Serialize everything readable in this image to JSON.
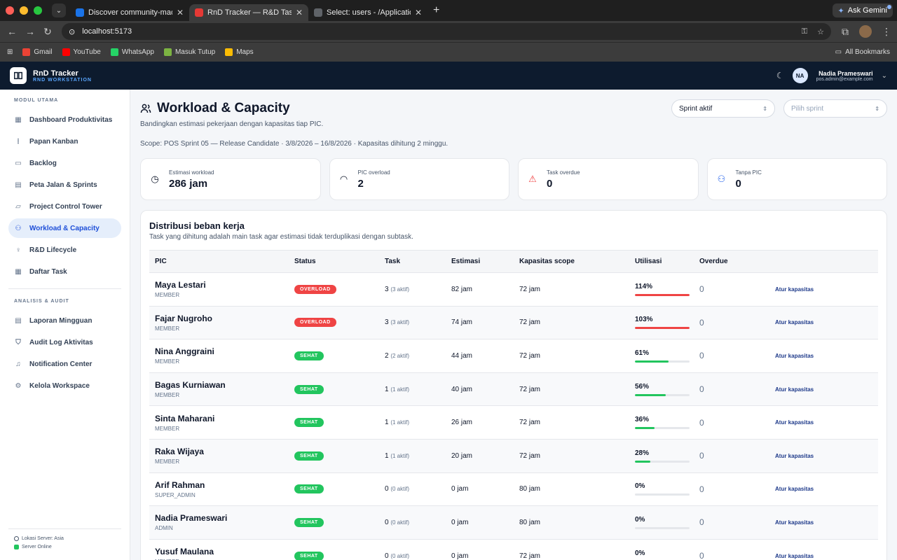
{
  "browser": {
    "tabs": [
      {
        "title": "Discover community-made U",
        "active": false,
        "color": "#1a73e8"
      },
      {
        "title": "RnD Tracker — R&D Task Man",
        "active": true,
        "color": "#e53935"
      },
      {
        "title": "Select: users - /Applications/",
        "active": false,
        "color": "#5f6368"
      }
    ],
    "gemini_label": "Ask Gemini",
    "url": "localhost:5173",
    "bookmarks": [
      {
        "label": "Gmail",
        "color": "#ea4335"
      },
      {
        "label": "YouTube",
        "color": "#ff0000"
      },
      {
        "label": "WhatsApp",
        "color": "#25d366"
      },
      {
        "label": "Masuk Tutup",
        "color": "#7cb342"
      },
      {
        "label": "Maps",
        "color": "#fbbc04"
      }
    ],
    "all_bookmarks": "All Bookmarks"
  },
  "header": {
    "brand_name": "RnD Tracker",
    "brand_sub": "RND WORKSTATION",
    "avatar_initials": "NA",
    "user_name": "Nadia Prameswari",
    "user_email": "pos.admin@example.com"
  },
  "sidebar": {
    "section1_title": "MODUL UTAMA",
    "section1_items": [
      {
        "label": "Dashboard Produktivitas",
        "icon": "grid-icon",
        "glyph": "▦",
        "active": false
      },
      {
        "label": "Papan Kanban",
        "icon": "kanban-icon",
        "glyph": "⦙",
        "active": false
      },
      {
        "label": "Backlog",
        "icon": "inbox-icon",
        "glyph": "▭",
        "active": false
      },
      {
        "label": "Peta Jalan & Sprints",
        "icon": "calendar-icon",
        "glyph": "▤",
        "active": false
      },
      {
        "label": "Project Control Tower",
        "icon": "folder-icon",
        "glyph": "▱",
        "active": false
      },
      {
        "label": "Workload & Capacity",
        "icon": "users-icon",
        "glyph": "⚇",
        "active": true
      },
      {
        "label": "R&D Lifecycle",
        "icon": "lightbulb-icon",
        "glyph": "♀",
        "active": false
      },
      {
        "label": "Daftar Task",
        "icon": "table-icon",
        "glyph": "▦",
        "active": false
      }
    ],
    "section2_title": "ANALISIS & AUDIT",
    "section2_items": [
      {
        "label": "Laporan Mingguan",
        "icon": "report-icon",
        "glyph": "▤",
        "active": false
      },
      {
        "label": "Audit Log Aktivitas",
        "icon": "shield-icon",
        "glyph": "⛉",
        "active": false
      },
      {
        "label": "Notification Center",
        "icon": "bell-icon",
        "glyph": "♫",
        "active": false
      },
      {
        "label": "Kelola Workspace",
        "icon": "gear-icon",
        "glyph": "⚙",
        "active": false
      }
    ],
    "server_location": "Lokasi Server: Asia",
    "server_status": "Server Online"
  },
  "page": {
    "title": "Workload & Capacity",
    "subtitle": "Bandingkan estimasi pekerjaan dengan kapasitas tiap PIC.",
    "scope": "Scope: POS Sprint 05 — Release Candidate · 3/8/2026 – 16/8/2026 · Kapasitas dihitung 2 minggu.",
    "filter_mode": "Sprint aktif",
    "filter_sprint_placeholder": "Pilih sprint"
  },
  "stats": [
    {
      "label": "Estimasi workload",
      "value": "286 jam",
      "icon": "clock-icon",
      "glyph": "◷",
      "color": "#0f172a"
    },
    {
      "label": "PIC overload",
      "value": "2",
      "icon": "gauge-icon",
      "glyph": "◠",
      "color": "#0f172a"
    },
    {
      "label": "Task overdue",
      "value": "0",
      "icon": "alert-icon",
      "glyph": "⚠",
      "color": "#ef4444"
    },
    {
      "label": "Tanpa PIC",
      "value": "0",
      "icon": "users-icon",
      "glyph": "⚇",
      "color": "#2563eb"
    }
  ],
  "table": {
    "title": "Distribusi beban kerja",
    "subtitle": "Task yang dihitung adalah main task agar estimasi tidak terduplikasi dengan subtask.",
    "columns": [
      "PIC",
      "Status",
      "Task",
      "Estimasi",
      "Kapasitas scope",
      "Utilisasi",
      "Overdue",
      ""
    ],
    "action_label": "Atur kapasitas",
    "colors": {
      "overload": "#ef4444",
      "sehat": "#22c55e"
    },
    "rows": [
      {
        "name": "Maya Lestari",
        "role": "MEMBER",
        "status": "OVERLOAD",
        "task": "3",
        "active": "(3 aktif)",
        "estimate": "82 jam",
        "capacity": "72 jam",
        "util": "114%",
        "util_value": 114,
        "overdue": "0"
      },
      {
        "name": "Fajar Nugroho",
        "role": "MEMBER",
        "status": "OVERLOAD",
        "task": "3",
        "active": "(3 aktif)",
        "estimate": "74 jam",
        "capacity": "72 jam",
        "util": "103%",
        "util_value": 103,
        "overdue": "0"
      },
      {
        "name": "Nina Anggraini",
        "role": "MEMBER",
        "status": "SEHAT",
        "task": "2",
        "active": "(2 aktif)",
        "estimate": "44 jam",
        "capacity": "72 jam",
        "util": "61%",
        "util_value": 61,
        "overdue": "0"
      },
      {
        "name": "Bagas Kurniawan",
        "role": "MEMBER",
        "status": "SEHAT",
        "task": "1",
        "active": "(1 aktif)",
        "estimate": "40 jam",
        "capacity": "72 jam",
        "util": "56%",
        "util_value": 56,
        "overdue": "0"
      },
      {
        "name": "Sinta Maharani",
        "role": "MEMBER",
        "status": "SEHAT",
        "task": "1",
        "active": "(1 aktif)",
        "estimate": "26 jam",
        "capacity": "72 jam",
        "util": "36%",
        "util_value": 36,
        "overdue": "0"
      },
      {
        "name": "Raka Wijaya",
        "role": "MEMBER",
        "status": "SEHAT",
        "task": "1",
        "active": "(1 aktif)",
        "estimate": "20 jam",
        "capacity": "72 jam",
        "util": "28%",
        "util_value": 28,
        "overdue": "0"
      },
      {
        "name": "Arif Rahman",
        "role": "SUPER_ADMIN",
        "status": "SEHAT",
        "task": "0",
        "active": "(0 aktif)",
        "estimate": "0 jam",
        "capacity": "80 jam",
        "util": "0%",
        "util_value": 0,
        "overdue": "0"
      },
      {
        "name": "Nadia Prameswari",
        "role": "ADMIN",
        "status": "SEHAT",
        "task": "0",
        "active": "(0 aktif)",
        "estimate": "0 jam",
        "capacity": "80 jam",
        "util": "0%",
        "util_value": 0,
        "overdue": "0"
      },
      {
        "name": "Yusuf Maulana",
        "role": "MEMBER",
        "status": "SEHAT",
        "task": "0",
        "active": "(0 aktif)",
        "estimate": "0 jam",
        "capacity": "72 jam",
        "util": "0%",
        "util_value": 0,
        "overdue": "0"
      }
    ]
  }
}
